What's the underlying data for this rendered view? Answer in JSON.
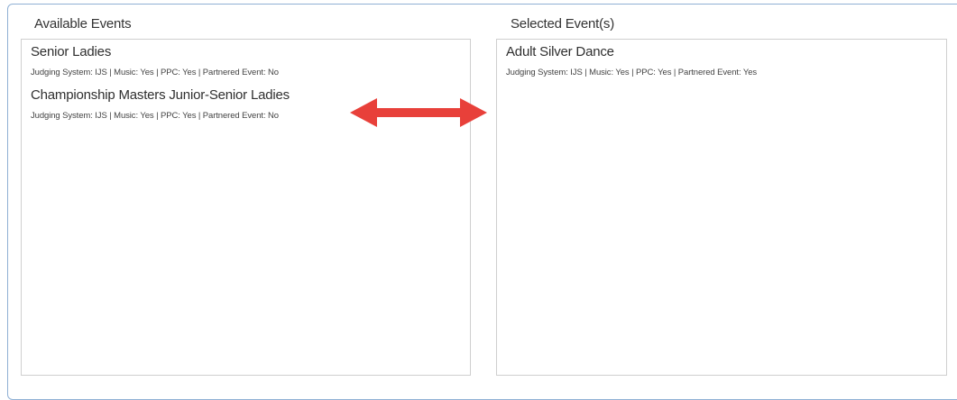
{
  "available": {
    "title": "Available Events",
    "events": [
      {
        "name": "Senior Ladies",
        "meta": "Judging System: IJS | Music: Yes | PPC: Yes | Partnered Event: No"
      },
      {
        "name": "Championship Masters Junior-Senior Ladies",
        "meta": "Judging System: IJS | Music: Yes | PPC: Yes | Partnered Event: No"
      }
    ]
  },
  "selected": {
    "title": "Selected Event(s)",
    "events": [
      {
        "name": "Adult Silver Dance",
        "meta": "Judging System: IJS | Music: Yes | PPC: Yes | Partnered Event: Yes"
      }
    ]
  },
  "colors": {
    "arrow": "#e8403a",
    "frame_border": "#8fb0d4",
    "list_border": "#cfcfcf"
  },
  "icons": {
    "transfer": "double-arrow-icon"
  }
}
